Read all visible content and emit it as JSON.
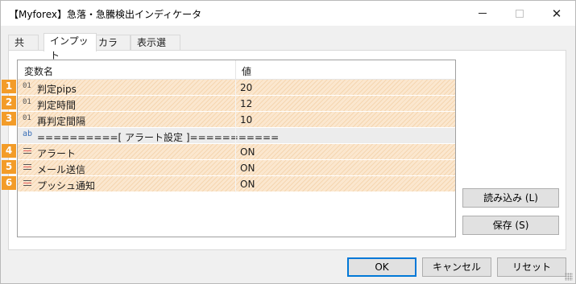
{
  "window": {
    "title": "【Myforex】急落・急騰検出インディケータ",
    "controls": {
      "minimize": "minimize-icon",
      "maximize": "maximize-icon",
      "close": "✕"
    }
  },
  "tabs": [
    {
      "label": "共有"
    },
    {
      "label": "インプット",
      "active": true
    },
    {
      "label": "カラー"
    },
    {
      "label": "表示選択"
    }
  ],
  "grid": {
    "headers": {
      "name": "変数名",
      "value": "値"
    },
    "rows": [
      {
        "badge": "1",
        "icon": "01",
        "name": "判定pips",
        "value": "20"
      },
      {
        "badge": "2",
        "icon": "01",
        "name": "判定時間",
        "value": "12"
      },
      {
        "badge": "3",
        "icon": "01",
        "name": "再判定間隔",
        "value": "10"
      },
      {
        "badge": "",
        "icon": "ab",
        "name": "==========[ アラート設定 ]===========",
        "value": ""
      },
      {
        "badge": "4",
        "icon": "bool-icon",
        "name": "アラート",
        "value": "ON"
      },
      {
        "badge": "5",
        "icon": "bool-icon",
        "name": "メール送信",
        "value": "ON"
      },
      {
        "badge": "6",
        "icon": "bool-icon",
        "name": "プッシュ通知",
        "value": "ON"
      }
    ]
  },
  "buttons": {
    "load": "読み込み (L)",
    "save": "保存 (S)",
    "ok": "OK",
    "cancel": "キャンセル",
    "reset": "リセット"
  },
  "colors": {
    "badge": "#f39c28",
    "row_highlight": "#fbe7cf",
    "accent": "#0078d7"
  }
}
